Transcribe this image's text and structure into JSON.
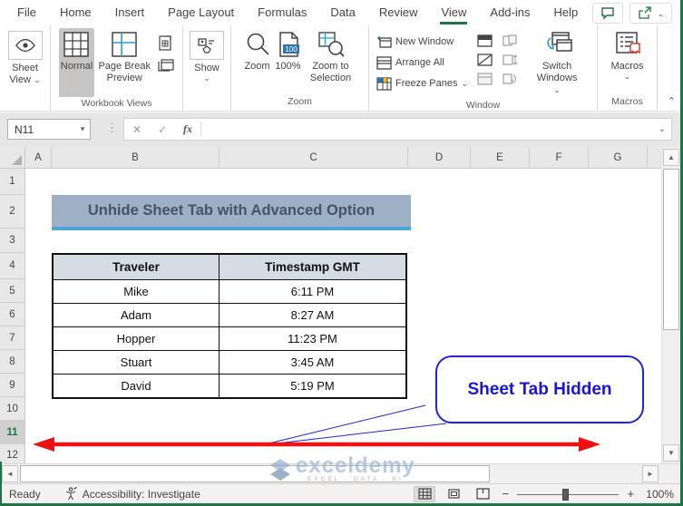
{
  "window": {
    "tabs": [
      "File",
      "Home",
      "Insert",
      "Page Layout",
      "Formulas",
      "Data",
      "Review",
      "View",
      "Add-ins",
      "Help"
    ],
    "active_tab": "View"
  },
  "ribbon": {
    "sheet_view_label": "Sheet View",
    "workbook_views": {
      "normal": "Normal",
      "page_break_preview": "Page Break Preview",
      "group_label": "Workbook Views"
    },
    "show_label": "Show",
    "zoom_group": {
      "zoom": "Zoom",
      "hundred": "100%",
      "zoom_to_selection": "Zoom to Selection",
      "group_label": "Zoom"
    },
    "window_group": {
      "new_window": "New Window",
      "arrange_all": "Arrange All",
      "freeze_panes": "Freeze Panes",
      "switch_windows": "Switch Windows",
      "group_label": "Window"
    },
    "macros_group": {
      "macros": "Macros",
      "group_label": "Macros"
    }
  },
  "formula_bar": {
    "name_box_value": "N11"
  },
  "sheet": {
    "column_headers": [
      "A",
      "B",
      "C",
      "D",
      "E",
      "F",
      "G"
    ],
    "row_headers": [
      "1",
      "2",
      "3",
      "4",
      "5",
      "6",
      "7",
      "8",
      "9",
      "10",
      "11",
      "12"
    ],
    "active_row": "11",
    "banner_title": "Unhide Sheet Tab with Advanced Option",
    "table": {
      "headers": [
        "Traveler",
        "Timestamp GMT"
      ],
      "rows": [
        [
          "Mike",
          "6:11 PM"
        ],
        [
          "Adam",
          "8:27 AM"
        ],
        [
          "Hopper",
          "11:23 PM"
        ],
        [
          "Stuart",
          "3:45 AM"
        ],
        [
          "David",
          "5:19 PM"
        ]
      ]
    },
    "callout_text": "Sheet Tab Hidden"
  },
  "watermark": {
    "brand": "exceldemy",
    "tagline": "EXCEL · DATA · BI"
  },
  "status_bar": {
    "mode": "Ready",
    "accessibility": "Accessibility: Investigate",
    "zoom_level": "100%"
  },
  "icons": {
    "chevron_down": "⌄",
    "collapse_ribbon": "⌃",
    "name_box_arrow": "▾",
    "cancel": "✕",
    "enter": "✓",
    "fx": "fx",
    "dots": "⋮",
    "scroll_up": "▲",
    "scroll_down": "▼",
    "scroll_left": "◄",
    "scroll_right": "►",
    "minus": "−",
    "plus": "+"
  },
  "colors": {
    "excel_green": "#217346",
    "banner_fill": "#9DB0C4",
    "banner_text": "#44546A",
    "banner_underline": "#4FA3DC",
    "table_header_fill": "#D6DCE4",
    "callout_blue": "#2323DC",
    "arrow_red": "#EE1111"
  }
}
